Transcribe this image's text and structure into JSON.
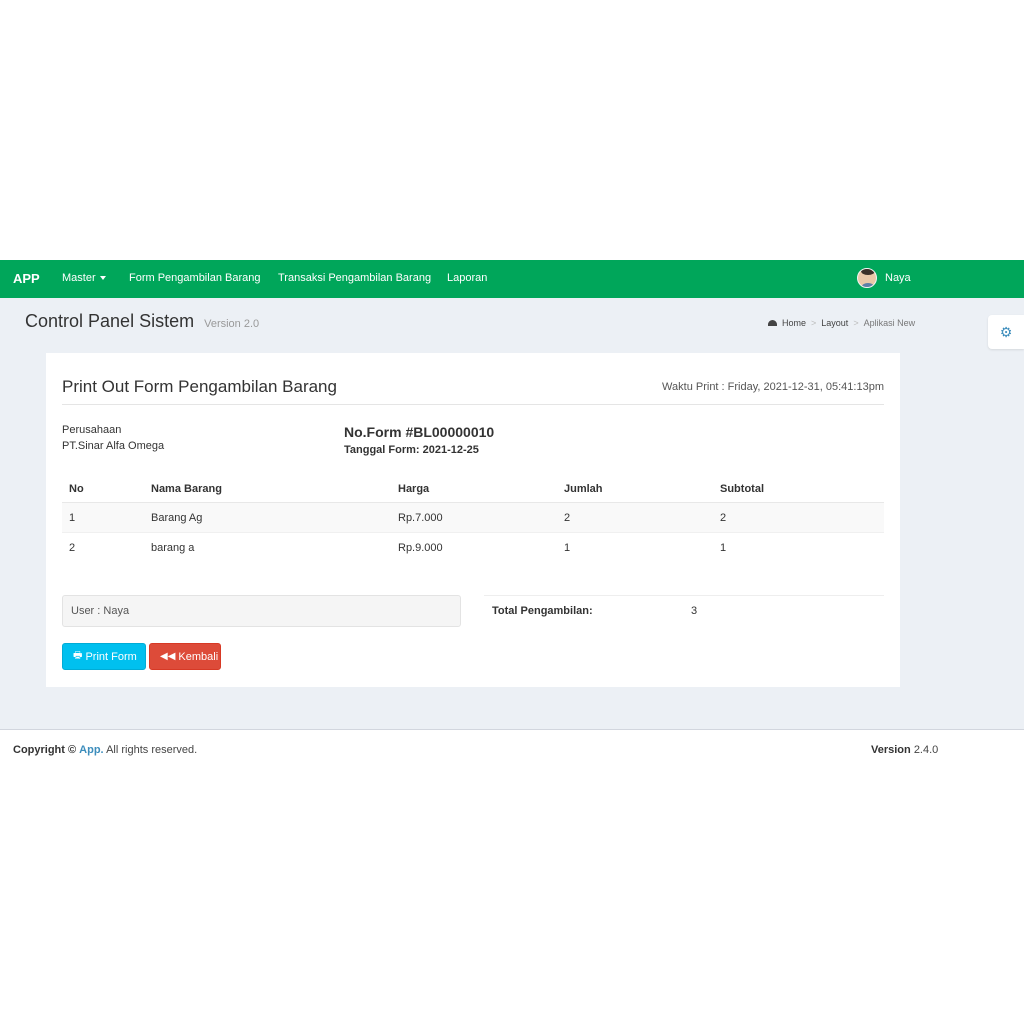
{
  "navbar": {
    "brand": "APP",
    "items": [
      {
        "label": "Master"
      },
      {
        "label": "Form Pengambilan Barang"
      },
      {
        "label": "Transaksi Pengambilan Barang"
      },
      {
        "label": "Laporan"
      }
    ],
    "user": "Naya",
    "bg_color": "#00a65a"
  },
  "header": {
    "title": "Control Panel Sistem",
    "subtitle": "Version 2.0",
    "breadcrumb": [
      "Home",
      "Layout",
      "Aplikasi New"
    ],
    "gear_icon": "gear-icon"
  },
  "box": {
    "title": "Print Out Form Pengambilan Barang",
    "print_time": "Waktu Print : Friday, 2021-12-31, 05:41:13pm",
    "company_label": "Perusahaan",
    "company_name": "PT.Sinar Alfa Omega",
    "form_no": "No.Form #BL00000010",
    "form_date": "Tanggal Form: 2021-12-25",
    "table": {
      "headers": [
        "No",
        "Nama Barang",
        "Harga",
        "Jumlah",
        "Subtotal"
      ],
      "rows": [
        [
          "1",
          "Barang Ag",
          "Rp.7.000",
          "2",
          "2"
        ],
        [
          "2",
          "barang a",
          "Rp.9.000",
          "1",
          "1"
        ]
      ]
    },
    "user_info": "User : Naya",
    "total_label": "Total Pengambilan:",
    "total_value": "3",
    "print_button": "Print Form",
    "back_button": "Kembali"
  },
  "footer": {
    "copyright_prefix": "Copyright ©",
    "app_link": "App.",
    "rights": "All rights reserved.",
    "version_label": "Version",
    "version_value": "2.4.0"
  }
}
